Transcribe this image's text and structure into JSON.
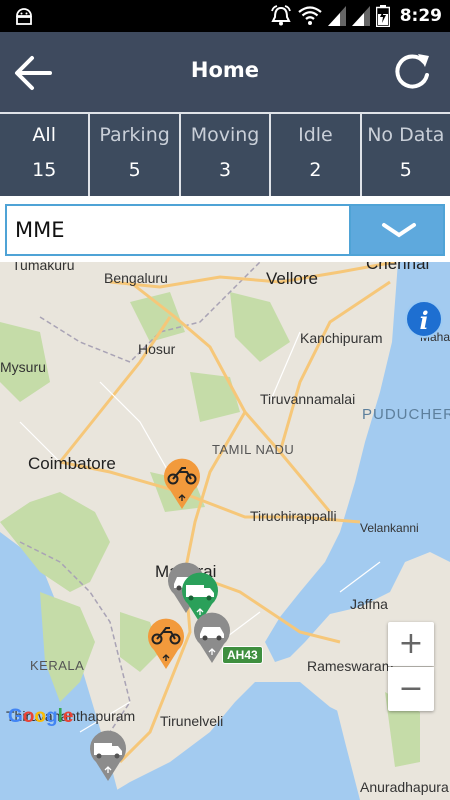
{
  "status_bar": {
    "time": "8:29",
    "icons": [
      "android-icon",
      "alarm-icon",
      "wifi-icon",
      "signal-icon",
      "signal-icon",
      "battery-icon"
    ]
  },
  "toolbar": {
    "title": "Home",
    "back_icon": "arrow-left-icon",
    "refresh_icon": "refresh-icon"
  },
  "tabs": [
    {
      "label": "All",
      "count": "15"
    },
    {
      "label": "Parking",
      "count": "5"
    },
    {
      "label": "Moving",
      "count": "3"
    },
    {
      "label": "Idle",
      "count": "2"
    },
    {
      "label": "No Data",
      "count": "5"
    }
  ],
  "search": {
    "value": "MME",
    "dropdown_icon": "chevron-down-icon"
  },
  "map": {
    "labels": {
      "tumakuru": "Tumakuru",
      "bengaluru": "Bengaluru",
      "vellore": "Vellore",
      "chennai": "Chennai",
      "kanchipuram": "Kanchipuram",
      "mahabalip": "Mahabalip",
      "hosur": "Hosur",
      "mysuru": "Mysuru",
      "tiruvannamalai": "Tiruvannamalai",
      "puducherry": "PUDUCHER",
      "tamil_nadu": "TAMIL NADU",
      "coimbatore": "Coimbatore",
      "tiruchirappalli": "Tiruchirappalli",
      "velankanni": "Velankanni",
      "madurai": "Madurai",
      "jaffna": "Jaffna",
      "kerala": "KERALA",
      "rameswaram": "Rameswaram",
      "thiruvananthapuram": "Thiruvananthapuram",
      "tirunelveli": "Tirunelveli",
      "anuradhapura": "Anuradhapura"
    },
    "highway_shield": "AH43",
    "attribution": "Google",
    "zoom_in": "+",
    "zoom_out": "−",
    "markers": [
      {
        "type": "motorbike-icon",
        "status": "idle",
        "color": "#f29a3c"
      },
      {
        "type": "car-icon",
        "status": "no-data",
        "color": "#8c8c8c"
      },
      {
        "type": "truck-icon",
        "status": "moving",
        "color": "#2aa05a"
      },
      {
        "type": "motorbike-icon",
        "status": "idle",
        "color": "#f29a3c"
      },
      {
        "type": "car-icon",
        "status": "no-data",
        "color": "#8c8c8c"
      },
      {
        "type": "truck-icon",
        "status": "no-data",
        "color": "#8c8c8c"
      }
    ],
    "info_icon": "info-icon",
    "colors": {
      "water": "#a3cbf0",
      "land": "#e9e5dc",
      "forest": "#c5dca8",
      "road": "#f6c779"
    }
  }
}
